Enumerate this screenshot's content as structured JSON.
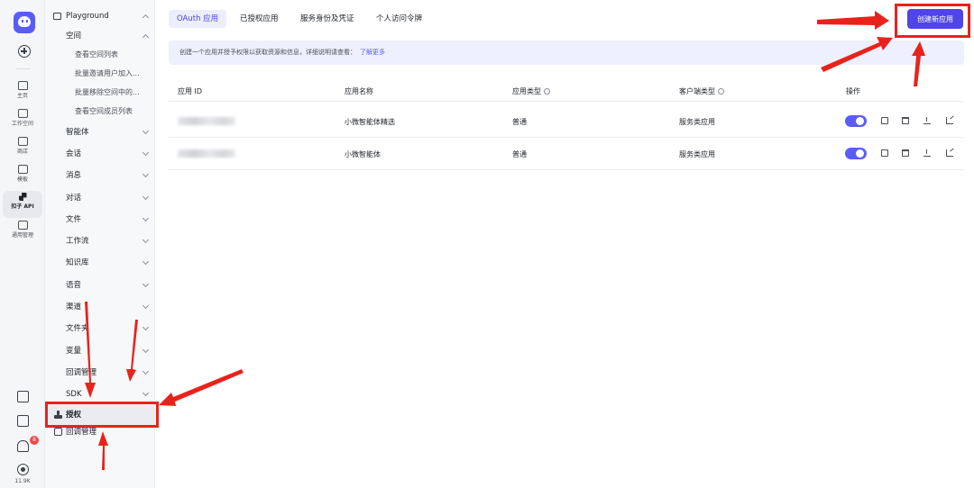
{
  "rail": {
    "items": [
      {
        "label": "主页"
      },
      {
        "label": "工作空间"
      },
      {
        "label": "商店"
      },
      {
        "label": "模板"
      },
      {
        "label": "扣子 API"
      },
      {
        "label": "通用管理"
      }
    ],
    "notification_count": "8",
    "bottom_count": "11.9K"
  },
  "sidebar": {
    "playground": "Playground",
    "space": "空间",
    "space_items": [
      "查看空间列表",
      "批量邀请用户加入...",
      "批量移除空间中的...",
      "查看空间成员列表"
    ],
    "groups": [
      "智能体",
      "会话",
      "消息",
      "对话",
      "文件",
      "工作流",
      "知识库",
      "语音",
      "渠道",
      "文件夹",
      "变量",
      "回调管理",
      "SDK"
    ],
    "auth": "授权",
    "callback": "回调管理"
  },
  "tabs": [
    "OAuth 应用",
    "已授权应用",
    "服务身份及凭证",
    "个人访问令牌"
  ],
  "create_button": "创建新应用",
  "banner": {
    "text": "创建一个应用并授予权限以获取资源和信息，详细说明请查看：",
    "link": "了解更多"
  },
  "table": {
    "headers": [
      "应用 ID",
      "应用名称",
      "应用类型",
      "客户端类型",
      "操作"
    ],
    "rows": [
      {
        "name": "小微智能体精选",
        "type": "普通",
        "client": "服务类应用",
        "enabled": true
      },
      {
        "name": "小微智能体",
        "type": "普通",
        "client": "服务类应用",
        "enabled": true
      }
    ]
  },
  "colors": {
    "accent": "#4f46e5",
    "annotation": "#e8231b"
  }
}
